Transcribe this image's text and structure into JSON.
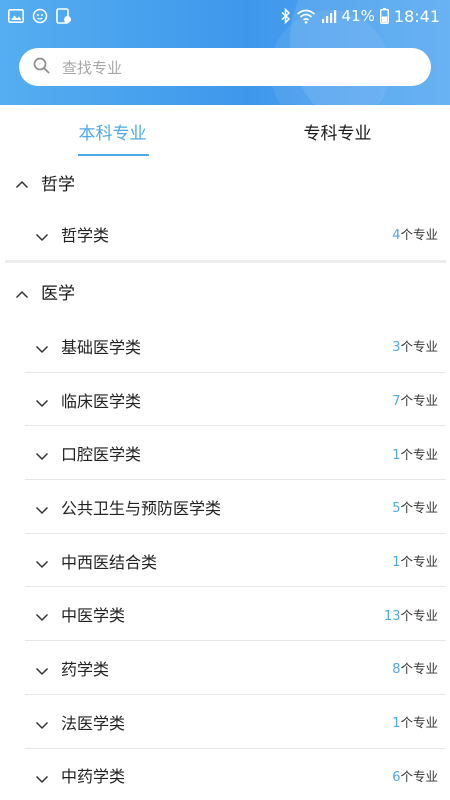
{
  "status_bar": {
    "bluetooth_icon": "bluetooth-icon",
    "wifi_icon": "wifi-icon",
    "signal_icon": "signal-icon",
    "battery_text": "41%",
    "time": "18:41"
  },
  "search": {
    "placeholder": "查找专业"
  },
  "tabs": [
    {
      "label": "本科专业",
      "active": true
    },
    {
      "label": "专科专业",
      "active": false
    }
  ],
  "sections": [
    {
      "title": "哲学",
      "items": [
        {
          "name": "哲学类",
          "count": "4",
          "suffix": "个专业"
        }
      ]
    },
    {
      "title": "医学",
      "items": [
        {
          "name": "基础医学类",
          "count": "3",
          "suffix": "个专业"
        },
        {
          "name": "临床医学类",
          "count": "7",
          "suffix": "个专业"
        },
        {
          "name": "口腔医学类",
          "count": "1",
          "suffix": "个专业"
        },
        {
          "name": "公共卫生与预防医学类",
          "count": "5",
          "suffix": "个专业"
        },
        {
          "name": "中西医结合类",
          "count": "1",
          "suffix": "个专业"
        },
        {
          "name": "中医学类",
          "count": "13",
          "suffix": "个专业"
        },
        {
          "name": "药学类",
          "count": "8",
          "suffix": "个专业"
        },
        {
          "name": "法医学类",
          "count": "1",
          "suffix": "个专业"
        },
        {
          "name": "中药学类",
          "count": "6",
          "suffix": "个专业"
        }
      ]
    }
  ],
  "colors": {
    "header": "#3f97ec",
    "accent": "#4fa9e6"
  }
}
